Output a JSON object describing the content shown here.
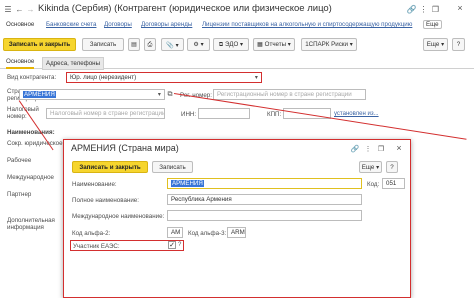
{
  "window": {
    "title": "Kikinda (Сербия) (Контрагент (юридическое или физическое лицо)"
  },
  "nav_tabs": [
    "Основное",
    "Банковские счета",
    "Договоры",
    "Договоры аренды",
    "Лицензии поставщиков на алкогольную и спиртосодержащую продукцию",
    "Еще"
  ],
  "toolbar": {
    "save_close": "Записать и закрыть",
    "save": "Записать",
    "edo": "ЭДО",
    "reports": "Отчеты",
    "spark": "1СПАРК Риски",
    "more": "Еще",
    "help": "?"
  },
  "form_tabs": [
    "Основное",
    "Адреса, телефоны"
  ],
  "form": {
    "vid_label": "Вид контрагента:",
    "vid_value": "Юр. лицо (нерезидент)",
    "country_label_1": "Страна",
    "country_label_2": "регистрации:",
    "country_value": "АРМЕНИЯ",
    "reg_label": "Рег. номер:",
    "reg_placeholder": "Регистрационный номер в стране регистрации",
    "tax_label_1": "Налоговый",
    "tax_label_2": "номер:",
    "tax_placeholder": "Налоговый номер в стране регистрации",
    "inn_label": "ИНН:",
    "kpp_label": "КПП:",
    "install_link": "установлен из...",
    "names_label": "Наименования:",
    "short_label_1": "Сокр. юридическое",
    "work_label": "Рабочее",
    "intl_label": "Международное",
    "partner_label": "Партнер",
    "extra_label_1": "Дополнительная",
    "extra_label_2": "информация"
  },
  "dialog": {
    "title": "АРМЕНИЯ (Страна мира)",
    "save_close": "Записать и закрыть",
    "save": "Записать",
    "more": "Еще",
    "help": "?",
    "name_label": "Наименование:",
    "name_value": "АРМЕНИЯ",
    "code_label": "Код:",
    "code_value": "051",
    "full_label": "Полное наименование:",
    "full_value": "Республика Армения",
    "intl_label": "Международное наименование:",
    "alpha2_label": "Код альфа-2:",
    "alpha2_value": "AM",
    "alpha3_label": "Код альфа-3:",
    "alpha3_value": "ARM",
    "eaes_label": "Участник ЕАЭС:",
    "eaes_check": "✓",
    "eaes_help": "?"
  }
}
